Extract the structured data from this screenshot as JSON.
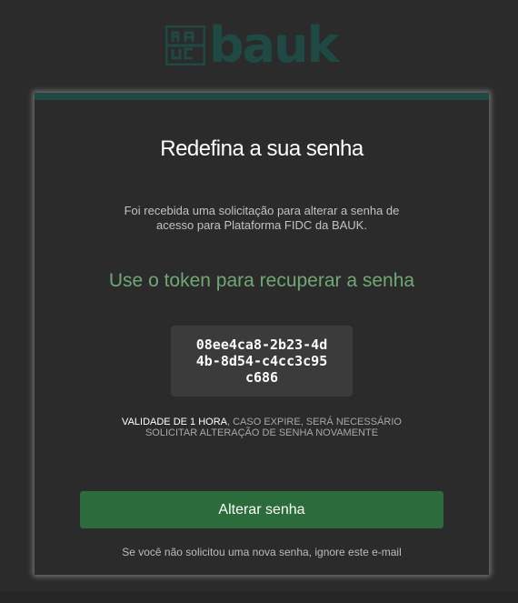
{
  "colors": {
    "brand": "#1f4a43",
    "accent": "#2c6b3b",
    "token_heading": "#6fa875",
    "background": "#2b2b2b"
  },
  "logo": {
    "mark_top": "BA",
    "mark_bottom": "UC",
    "word": "bauk"
  },
  "email": {
    "title": "Redefina a sua senha",
    "intro": "Foi recebida uma solicitação para alterar a senha de acesso para Plataforma FIDC da BAUK.",
    "token_heading": "Use o token para recuperar a senha",
    "token": "08ee4ca8-2b23-4d4b-8d54-c4cc3c95c686",
    "validity_strong": "VALIDADE DE 1 HORA",
    "validity_rest": ", CASO EXPIRE, SERÁ NECESSÁRIO SOLICITAR ALTERAÇÃO DE SENHA NOVAMENTE",
    "button_label": "Alterar senha",
    "footer_note": "Se você não solicitou uma nova senha, ignore este e-mail"
  }
}
